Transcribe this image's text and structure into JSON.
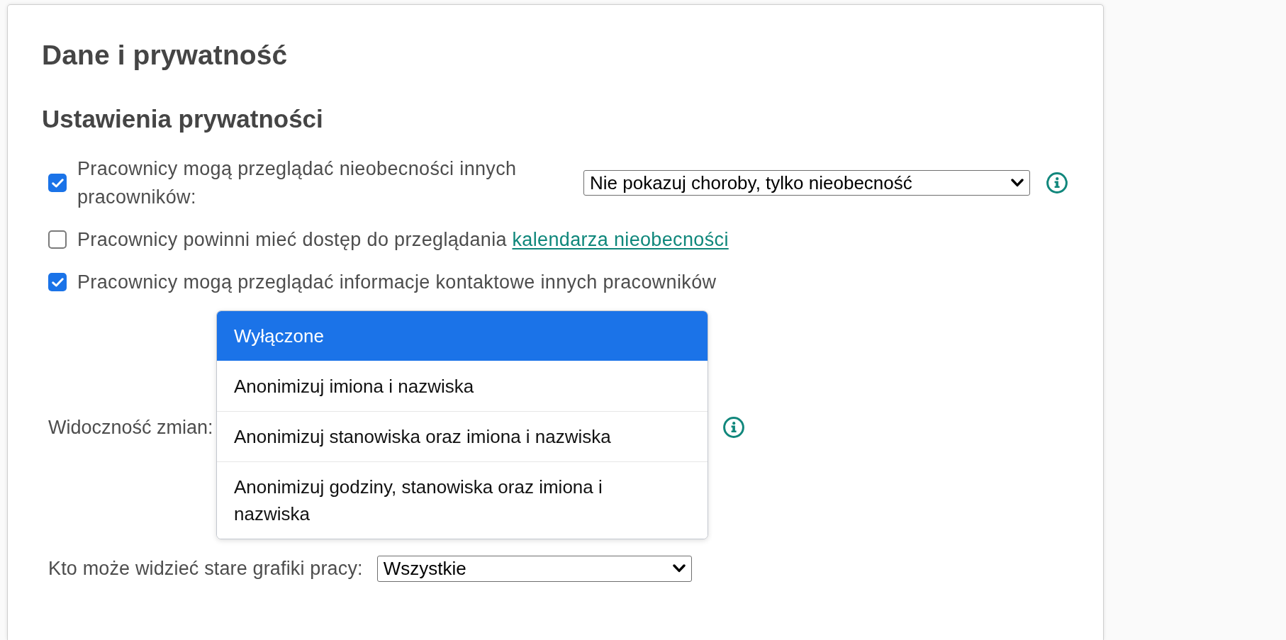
{
  "page": {
    "title": "Dane i prywatność"
  },
  "section": {
    "heading": "Ustawienia prywatności",
    "settings": [
      {
        "kind": "checkbox_select",
        "checked": true,
        "label": "Pracownicy mogą przeglądać nieobecności innych pracowników:",
        "value": "Nie pokazuj choroby, tylko nieobecność",
        "info": true
      },
      {
        "kind": "checkbox",
        "checked": false,
        "label": "Pracownicy powinni mieć dostęp do przeglądania",
        "link": "kalendarza nieobecności"
      },
      {
        "kind": "checkbox",
        "checked": true,
        "label": "Pracownicy mogą przeglądać informacje kontaktowe innych pracowników"
      },
      {
        "kind": "open_select",
        "label": "Widoczność zmian:",
        "info": true,
        "options": [
          {
            "label": "Wyłączone",
            "selected": true
          },
          {
            "label": "Anonimizuj imiona i nazwiska",
            "selected": false
          },
          {
            "label": "Anonimizuj stanowiska oraz imiona i nazwiska",
            "selected": false
          },
          {
            "label": "Anonimizuj godziny, stanowiska oraz imiona i nazwiska",
            "selected": false
          }
        ]
      },
      {
        "kind": "select",
        "label": "Kto może widzieć stare grafiki pracy:",
        "value": "Wszystkie"
      }
    ]
  }
}
